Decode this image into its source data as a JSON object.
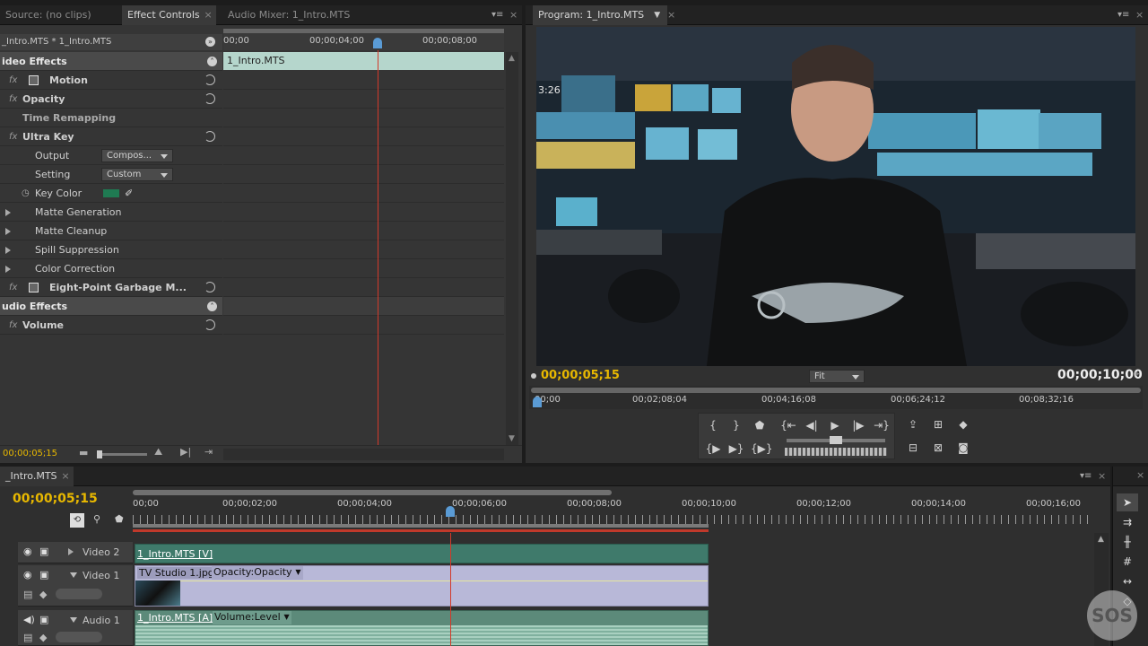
{
  "top_left_tabs": {
    "source": "Source: (no clips)",
    "effect_controls": "Effect Controls",
    "audio_mixer": "Audio Mixer: 1_Intro.MTS"
  },
  "effect_controls": {
    "clip_path": "_Intro.MTS * 1_Intro.MTS",
    "ruler": [
      "00;00",
      "00;00;04;00",
      "00;00;08;00"
    ],
    "clip_bar_label": "1_Intro.MTS",
    "video_effects_header": "ideo Effects",
    "motion": "Motion",
    "opacity": "Opacity",
    "time_remapping": "Time Remapping",
    "ultra_key": "Ultra Key",
    "output_label": "Output",
    "output_value": "Compos...",
    "setting_label": "Setting",
    "setting_value": "Custom",
    "key_color_label": "Key Color",
    "key_color": "#1f7a52",
    "matte_generation": "Matte Generation",
    "matte_cleanup": "Matte Cleanup",
    "spill_suppression": "Spill Suppression",
    "color_correction": "Color Correction",
    "garbage_matte": "Eight-Point Garbage M...",
    "audio_effects_header": "udio Effects",
    "volume": "Volume",
    "fx": "fx",
    "timecode": "00;00;05;15"
  },
  "program": {
    "tab": "Program: 1_Intro.MTS",
    "timecode": "00;00;05;15",
    "fit": "Fit",
    "duration": "00;00;10;00",
    "ruler": [
      "00;00",
      "00;02;08;04",
      "00;04;16;08",
      "00;06;24;12",
      "00;08;32;16"
    ],
    "overlay_text": "3:26"
  },
  "timeline": {
    "tab": "_Intro.MTS",
    "timecode": "00;00;05;15",
    "ruler": [
      "00;00",
      "00;00;02;00",
      "00;00;04;00",
      "00;00;06;00",
      "00;00;08;00",
      "00;00;10;00",
      "00;00;12;00",
      "00;00;14;00",
      "00;00;16;00"
    ],
    "video2": "Video 2",
    "video1": "Video 1",
    "audio1": "Audio 1",
    "clip_v2": "1_Intro.MTS [V]",
    "clip_v1": "TV Studio 1.jpg",
    "clip_v1_param": "Opacity:Opacity",
    "clip_a1": "1_Intro.MTS [A]",
    "clip_a1_param": "Volume:Level"
  },
  "watermark": "SOS",
  "colors": {
    "accent": "#e8b800",
    "playhead": "#d23a2a",
    "video_clip": "#3f7a6b",
    "still_clip": "#b8b8d8",
    "audio_clip": "#5c8a7a",
    "key_color": "#1f7a52"
  }
}
